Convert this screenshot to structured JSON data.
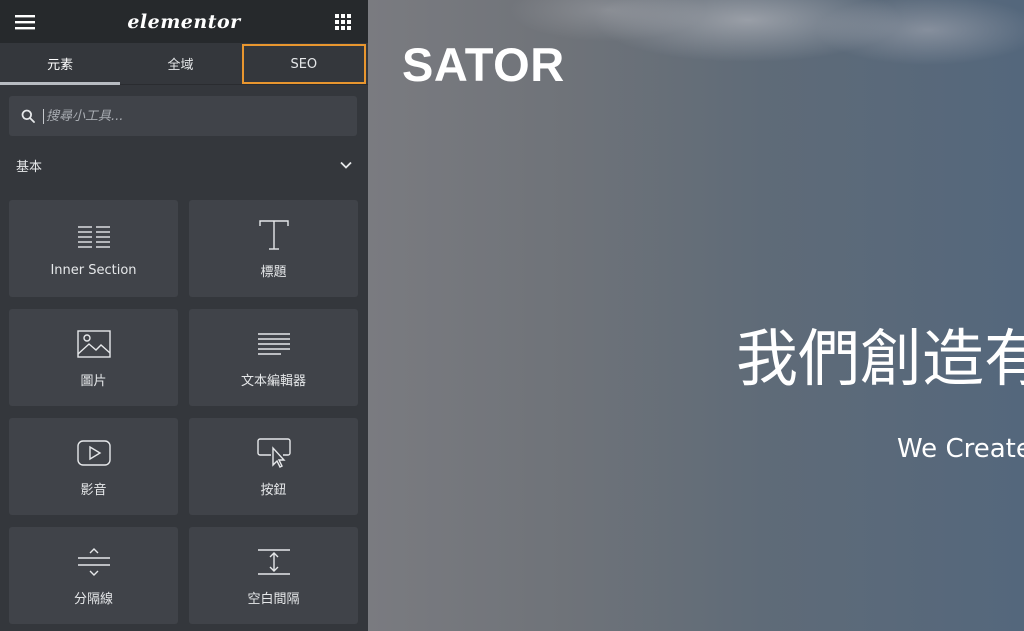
{
  "topbar": {
    "logo": "elementor",
    "menu_icon": "hamburger-icon",
    "apps_icon": "grid-icon"
  },
  "tabs": [
    {
      "label": "元素",
      "active": true
    },
    {
      "label": "全域",
      "active": false
    },
    {
      "label": "SEO",
      "active": false,
      "highlight_color": "#e8962f"
    }
  ],
  "search": {
    "placeholder": "搜尋小工具...",
    "icon": "search-icon"
  },
  "category": {
    "label": "基本",
    "icon": "chevron-down-icon"
  },
  "widgets": [
    {
      "label": "Inner Section",
      "icon": "columns-icon"
    },
    {
      "label": "標題",
      "icon": "heading-icon"
    },
    {
      "label": "圖片",
      "icon": "image-icon"
    },
    {
      "label": "文本編輯器",
      "icon": "text-editor-icon"
    },
    {
      "label": "影音",
      "icon": "video-icon"
    },
    {
      "label": "按鈕",
      "icon": "button-icon"
    },
    {
      "label": "分隔線",
      "icon": "divider-icon"
    },
    {
      "label": "空白間隔",
      "icon": "spacer-icon"
    }
  ],
  "canvas": {
    "brand": "SATOR",
    "hero_title": "我們創造有",
    "hero_subtitle": "We Create"
  },
  "colors": {
    "panel_bg": "#34373c",
    "topbar_bg": "#26292c",
    "widget_bg": "#404349",
    "seo_outline": "#e8962f"
  }
}
